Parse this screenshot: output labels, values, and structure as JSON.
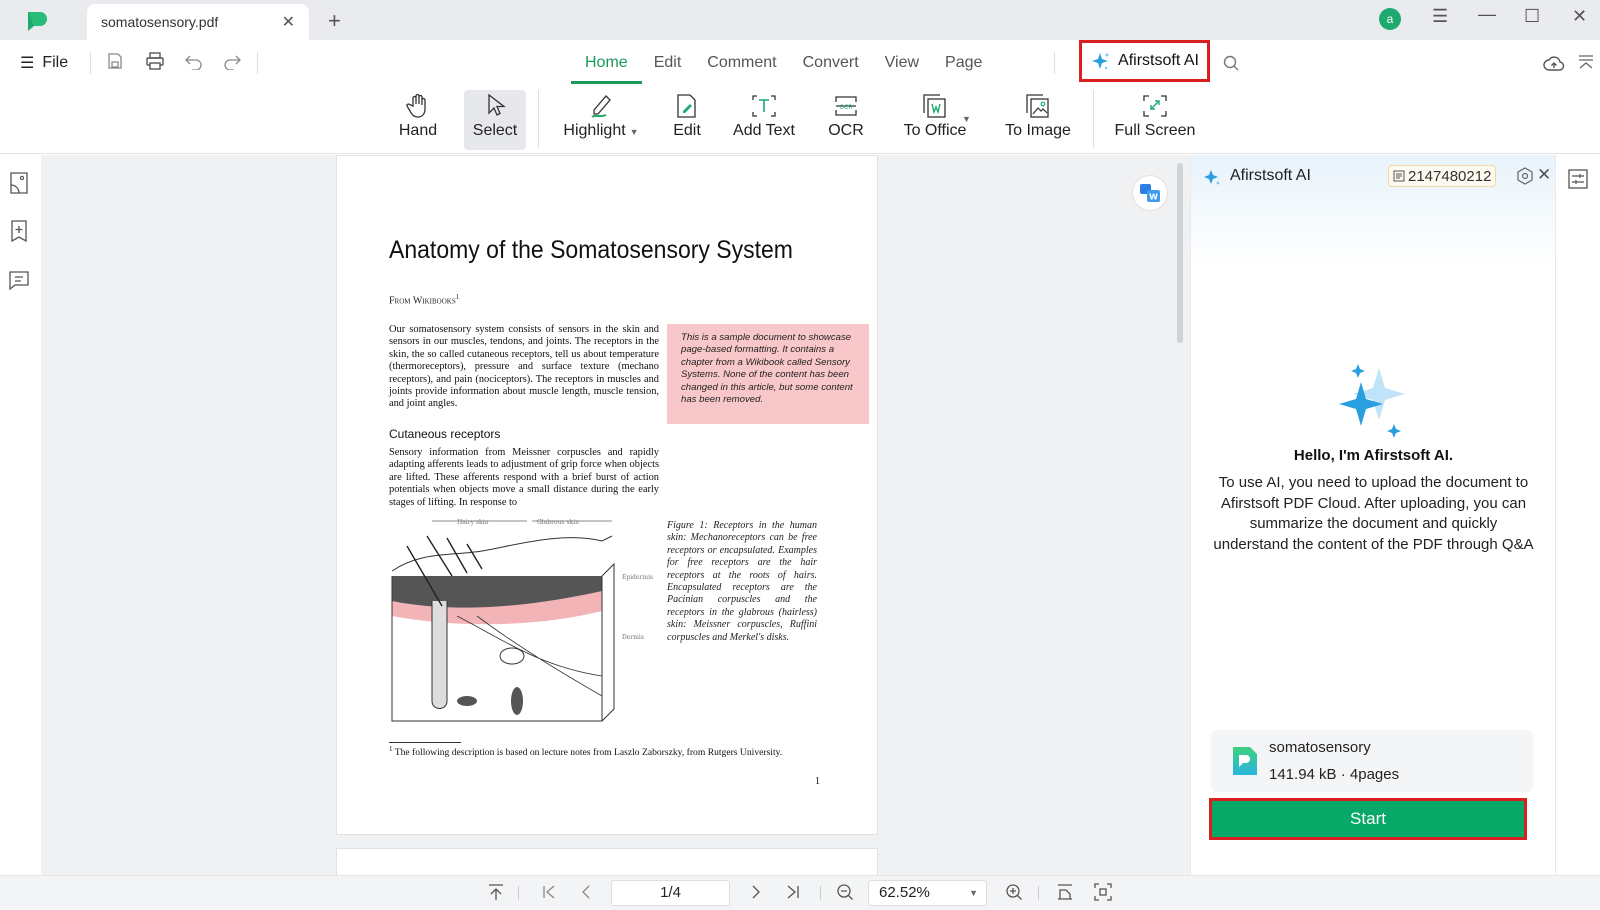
{
  "titlebar": {
    "tab_title": "somatosensory.pdf",
    "avatar_letter": "a",
    "icons": [
      "app-logo-icon",
      "close-icon",
      "plus-icon",
      "menu-icon",
      "minimize-icon",
      "maximize-icon",
      "close-window-icon"
    ]
  },
  "menubar": {
    "file_label": "File",
    "tabs": [
      {
        "label": "Home",
        "active": true
      },
      {
        "label": "Edit",
        "active": false
      },
      {
        "label": "Comment",
        "active": false
      },
      {
        "label": "Convert",
        "active": false
      },
      {
        "label": "View",
        "active": false
      },
      {
        "label": "Page",
        "active": false
      }
    ],
    "ai_label": "Afirstsoft AI"
  },
  "ribbon": {
    "tools": [
      {
        "label": "Hand",
        "icon": "hand-icon"
      },
      {
        "label": "Select",
        "icon": "cursor-icon",
        "selected": true
      },
      {
        "label": "Highlight",
        "icon": "highlight-pen-icon",
        "dropdown": true
      },
      {
        "label": "Edit",
        "icon": "edit-document-icon"
      },
      {
        "label": "Add Text",
        "icon": "add-text-icon"
      },
      {
        "label": "OCR",
        "icon": "ocr-icon"
      },
      {
        "label": "To Office",
        "icon": "to-office-icon",
        "dropdown": true
      },
      {
        "label": "To Image",
        "icon": "to-image-icon"
      },
      {
        "label": "Full Screen",
        "icon": "full-screen-icon"
      }
    ]
  },
  "document": {
    "title": "Anatomy of the Somatosensory System",
    "from": "From Wikibooks",
    "from_sup": "1",
    "para1": "Our somatosensory system consists of sensors in the skin and sensors in our muscles, tendons, and joints. The receptors in the skin, the so called cutaneous receptors, tell us about temperature (thermoreceptors), pressure and surface texture (mechano receptors), and pain (nociceptors). The receptors in muscles and joints provide information about muscle length, muscle tension, and joint angles.",
    "note_box": "This is a sample document to showcase page-based formatting. It contains a chapter from a Wikibook called Sensory Systems. None of the content has been changed in this article, but some content has been removed.",
    "heading": "Cutaneous receptors",
    "para2": "Sensory information from Meissner corpuscles and rapidly adapting afferents leads to adjustment of grip force when objects are lifted. These afferents respond with a brief burst of action potentials when objects move a small distance during the early stages of lifting. In response to",
    "figure_caption": "Figure 1: Receptors in the human skin: Mechanoreceptors can be free receptors or encapsulated. Examples for free receptors are the hair receptors at the roots of hairs. Encapsulated receptors are the Pacinian corpuscles and the receptors in the glabrous (hairless) skin: Meissner corpuscles, Ruffini corpuscles and Merkel's disks.",
    "figure_labels": {
      "hairy": "Hairy skin",
      "glabrous": "Glabrous skin",
      "epidermis": "Epidermis",
      "dermis": "Dermis"
    },
    "footnote_sup": "1",
    "footnote": "The following description is based on lecture notes from Laszlo Zaborszky, from Rutgers University.",
    "page_number": "1"
  },
  "ai_panel": {
    "title": "Afirstsoft AI",
    "credits": "2147480212",
    "hello": "Hello, I'm Afirstsoft AI.",
    "description": "To use AI, you need to upload the document to Afirstsoft PDF Cloud. After uploading, you can summarize the document and quickly understand the content of the PDF through Q&A",
    "file_name": "somatosensory",
    "file_meta": "141.94 kB · 4pages",
    "start_label": "Start"
  },
  "statusbar": {
    "page_value": "1/4",
    "zoom_value": "62.52%"
  },
  "colors": {
    "accent_green": "#1a9a5b",
    "start_button": "#07a868",
    "highlight_red_border": "#d91f1f",
    "note_pink": "#f8c7c9",
    "ai_blue": "#2a9fe0"
  }
}
